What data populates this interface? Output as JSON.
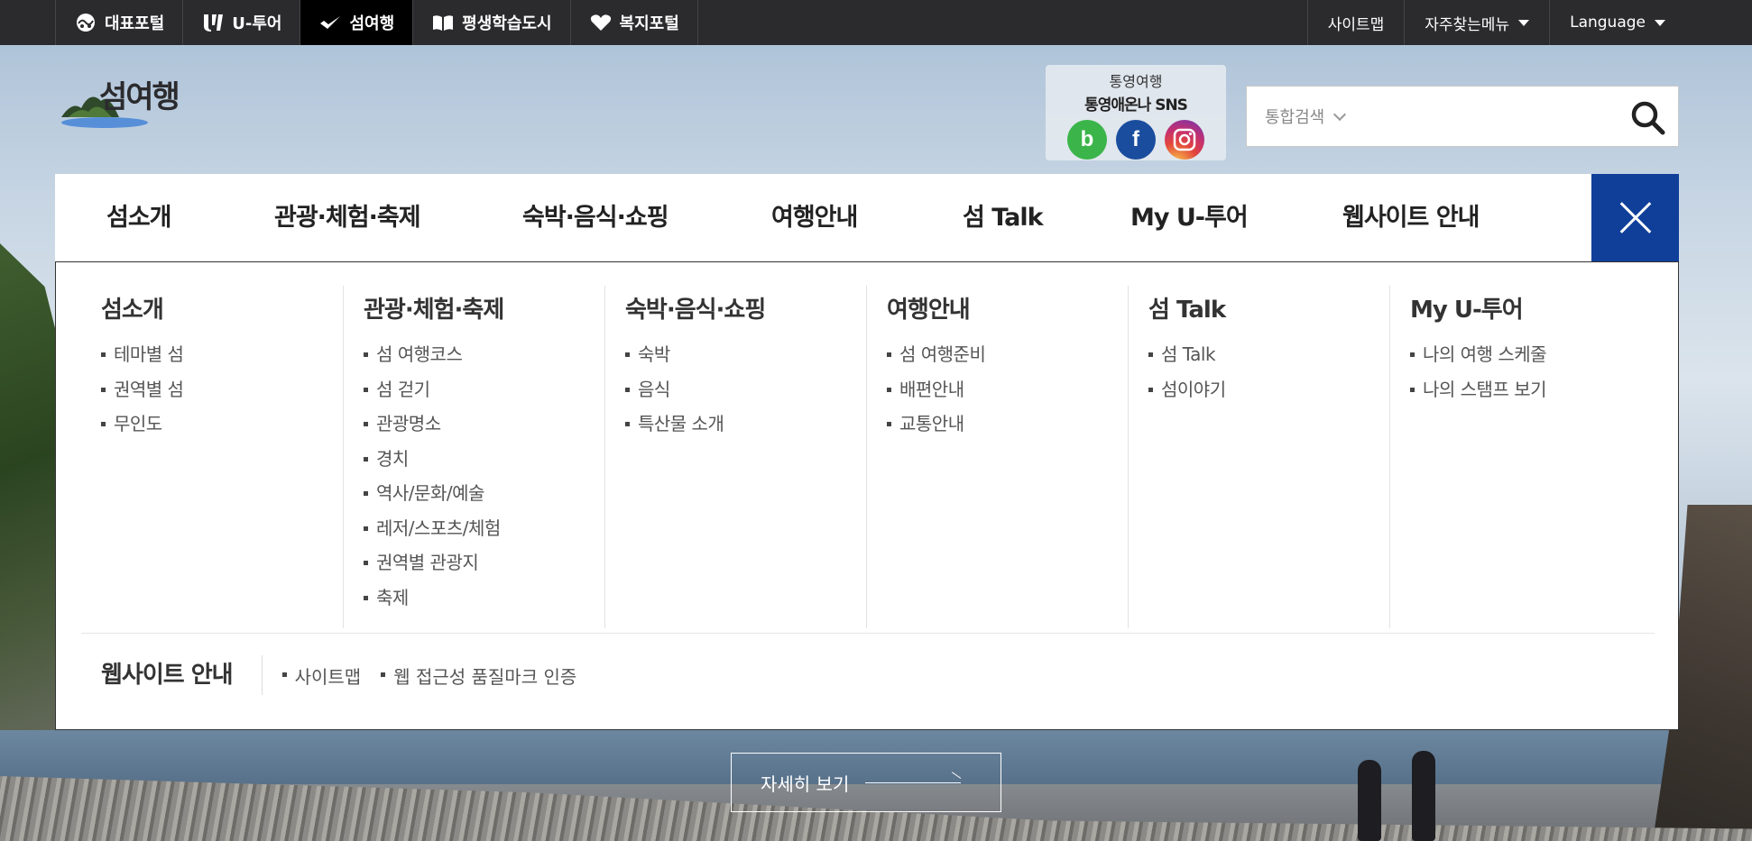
{
  "topbar": {
    "portals": [
      {
        "label": "대표포털",
        "icon": "portal-icon"
      },
      {
        "label": "U-투어",
        "icon": "utour-icon"
      },
      {
        "label": "섬여행",
        "icon": "bird-icon"
      },
      {
        "label": "평생학습도시",
        "icon": "book-icon"
      },
      {
        "label": "복지포털",
        "icon": "heart-icon"
      }
    ],
    "active_portal": "섬여행",
    "utils": [
      {
        "label": "사이트맵"
      },
      {
        "label": "자주찾는메뉴"
      },
      {
        "label": "Language"
      }
    ]
  },
  "header": {
    "logo_text": "섬여행",
    "sns": {
      "subtitle": "통영여행",
      "title": "통영애온나 SNS",
      "icons": [
        {
          "name": "blog",
          "glyph": "b",
          "color": "#3bb54a"
        },
        {
          "name": "facebook",
          "glyph": "f",
          "color": "#1a4d9e"
        },
        {
          "name": "instagram",
          "color": "#c5306f"
        }
      ]
    },
    "search": {
      "scope": "통합검색",
      "placeholder": ""
    }
  },
  "gnb": {
    "items": [
      "섬소개",
      "관광·체험·축제",
      "숙박·음식·쇼핑",
      "여행안내",
      "섬 Talk",
      "My U-투어",
      "웹사이트 안내"
    ]
  },
  "mega": {
    "columns": [
      {
        "title": "섬소개",
        "links": [
          "테마별 섬",
          "권역별 섬",
          "무인도"
        ]
      },
      {
        "title": "관광·체험·축제",
        "links": [
          "섬 여행코스",
          "섬 걷기",
          "관광명소",
          "경치",
          "역사/문화/예술",
          "레저/스포츠/체험",
          "권역별 관광지",
          "축제"
        ]
      },
      {
        "title": "숙박·음식·쇼핑",
        "links": [
          "숙박",
          "음식",
          "특산물 소개"
        ]
      },
      {
        "title": "여행안내",
        "links": [
          "섬 여행준비",
          "배편안내",
          "교통안내"
        ]
      },
      {
        "title": "섬 Talk",
        "links": [
          "섬 Talk",
          "섬이야기"
        ]
      },
      {
        "title": "My U-투어",
        "links": [
          "나의 여행 스케줄",
          "나의 스탬프 보기"
        ]
      }
    ],
    "site_guide": {
      "title": "웹사이트 안내",
      "links": [
        "사이트맵",
        "웹 접근성 품질마크 인증"
      ]
    }
  },
  "hero": {
    "more_label": "자세히 보기"
  },
  "colors": {
    "topbar": "#2b2b2e",
    "accent": "#0f3f99"
  }
}
